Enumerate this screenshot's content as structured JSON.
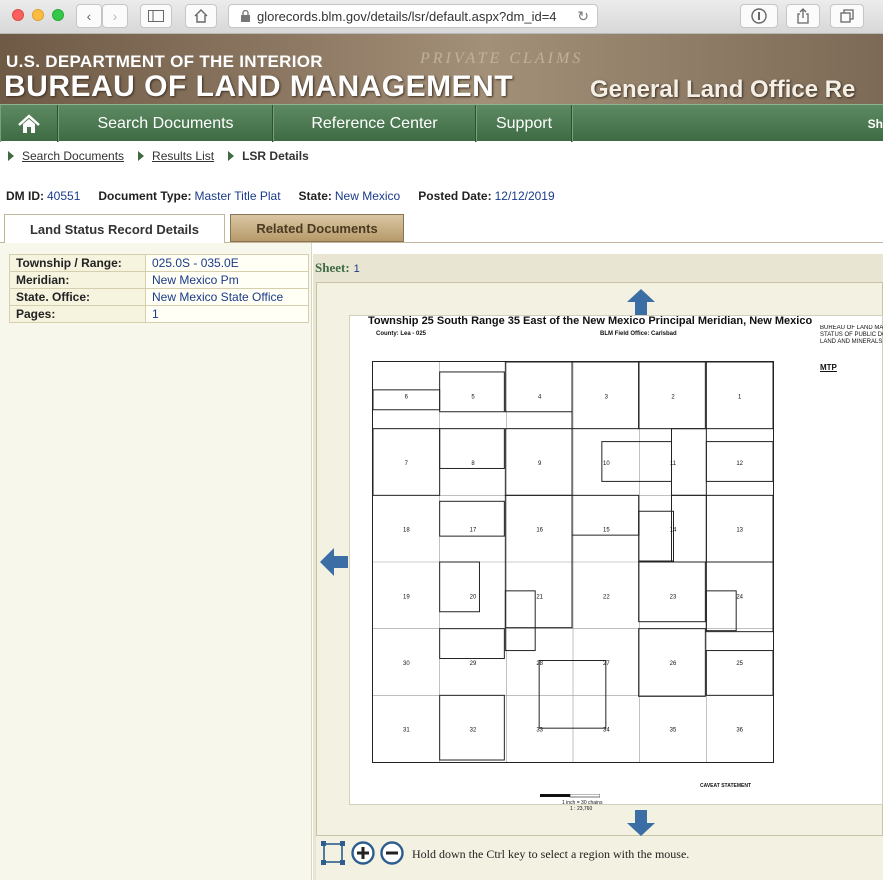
{
  "browser": {
    "url": "glorecords.blm.gov/details/lsr/default.aspx?dm_id=4"
  },
  "banner": {
    "department": "U.S. DEPARTMENT OF THE INTERIOR",
    "bureau": "BUREAU OF LAND MANAGEMENT",
    "office": "General Land Office Re",
    "watermark": "PRIVATE  CLAIMS"
  },
  "nav": {
    "search_documents": "Search Documents",
    "reference_center": "Reference Center",
    "support": "Support",
    "right_cut": "Sh"
  },
  "breadcrumb": {
    "search_documents": "Search Documents",
    "results_list": "Results List",
    "current": "LSR Details"
  },
  "info": {
    "dm_id_label": "DM ID:",
    "dm_id": "40551",
    "doc_type_label": "Document Type:",
    "doc_type": "Master Title Plat",
    "state_label": "State:",
    "state": "New Mexico",
    "posted_label": "Posted Date:",
    "posted": "12/12/2019"
  },
  "tabs": {
    "details": "Land Status Record Details",
    "related": "Related Documents"
  },
  "details": {
    "rows": [
      {
        "label": "Township / Range:",
        "value": "025.0S - 035.0E"
      },
      {
        "label": "Meridian:",
        "value": "New Mexico Pm"
      },
      {
        "label": "State. Office:",
        "value": "New Mexico State Office"
      },
      {
        "label": "Pages:",
        "value": "1"
      }
    ]
  },
  "viewer": {
    "sheet_label": "Sheet:",
    "sheet_value": "1",
    "hint": "Hold down the Ctrl key to select a region with the mouse."
  },
  "map": {
    "title": "Township 25 South Range 35 East of the New Mexico Principal Meridian, New Mexico",
    "county": "County:   Lea - 025",
    "field_office": "BLM Field Office:     Carlsbad",
    "side_lines": [
      "BUREAU OF LAND MA",
      "STATUS OF PUBLIC DO",
      "LAND AND MINERALS"
    ],
    "mtp": "MTP",
    "scale": "1 inch = 30 chains",
    "scale_ratio": "1 : 23,760",
    "caveat": "CAVEAT STATEMENT",
    "sections": [
      "6",
      "5",
      "4",
      "3",
      "2",
      "1",
      "7",
      "8",
      "9",
      "10",
      "11",
      "12",
      "18",
      "17",
      "16",
      "15",
      "14",
      "13",
      "19",
      "20",
      "21",
      "22",
      "23",
      "24",
      "30",
      "29",
      "28",
      "27",
      "26",
      "25",
      "31",
      "32",
      "33",
      "34",
      "35",
      "36"
    ]
  },
  "colors": {
    "nav_green": "#3f6b44",
    "link_blue": "#1a3a8a",
    "arrow_blue": "#3b6ea5"
  }
}
